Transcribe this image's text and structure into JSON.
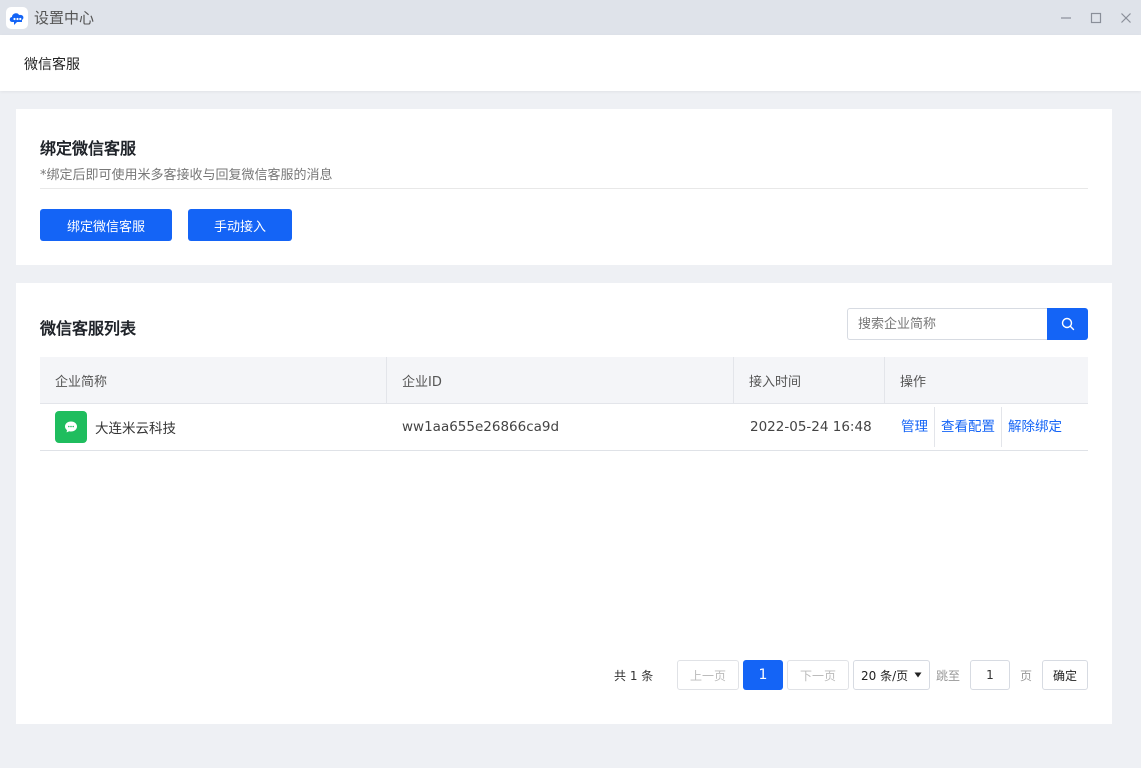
{
  "window": {
    "title": "设置中心"
  },
  "header": {
    "tab": "微信客服"
  },
  "bind": {
    "title": "绑定微信客服",
    "desc": "*绑定后即可使用米多客接收与回复微信客服的消息",
    "bind_button": "绑定微信客服",
    "manual_button": "手动接入"
  },
  "list": {
    "title": "微信客服列表",
    "search_placeholder": "搜索企业简称",
    "columns": [
      "企业简称",
      "企业ID",
      "接入时间",
      "操作"
    ],
    "rows": [
      {
        "name": "大连米云科技",
        "id": "ww1aa655e26866ca9d",
        "time": "2022-05-24 16:48",
        "actions": [
          "管理",
          "查看配置",
          "解除绑定"
        ]
      }
    ]
  },
  "pagination": {
    "total": "共 1 条",
    "prev": "上一页",
    "current": "1",
    "next": "下一页",
    "page_size": "20 条/页",
    "jump_label": "跳至",
    "jump_value": "1",
    "page_label": "页",
    "confirm": "确定"
  },
  "colors": {
    "primary": "#1464f6",
    "wechat_green": "#1fbd5e",
    "background": "#eef0f4"
  },
  "icons": {
    "app": "cloud-chat-icon",
    "search": "search-icon",
    "corp": "chat-bubble-icon"
  }
}
